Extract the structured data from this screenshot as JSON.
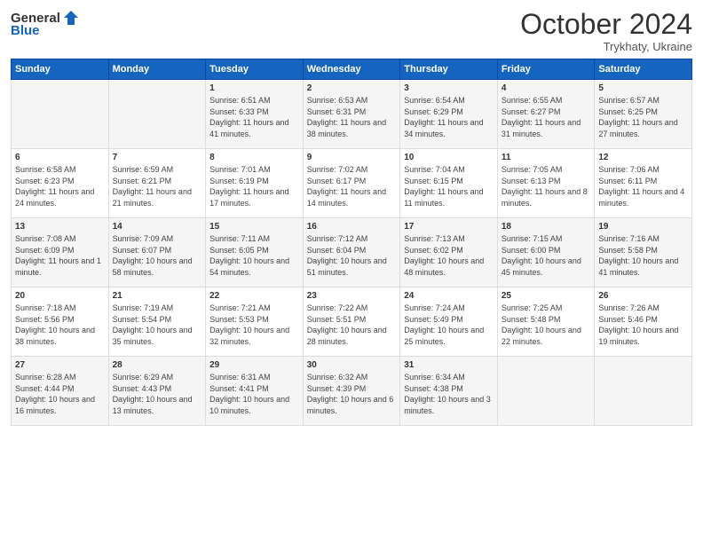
{
  "header": {
    "logo_general": "General",
    "logo_blue": "Blue",
    "month": "October 2024",
    "location": "Trykhaty, Ukraine"
  },
  "weekdays": [
    "Sunday",
    "Monday",
    "Tuesday",
    "Wednesday",
    "Thursday",
    "Friday",
    "Saturday"
  ],
  "weeks": [
    [
      {
        "day": "",
        "sunrise": "",
        "sunset": "",
        "daylight": ""
      },
      {
        "day": "",
        "sunrise": "",
        "sunset": "",
        "daylight": ""
      },
      {
        "day": "1",
        "sunrise": "Sunrise: 6:51 AM",
        "sunset": "Sunset: 6:33 PM",
        "daylight": "Daylight: 11 hours and 41 minutes."
      },
      {
        "day": "2",
        "sunrise": "Sunrise: 6:53 AM",
        "sunset": "Sunset: 6:31 PM",
        "daylight": "Daylight: 11 hours and 38 minutes."
      },
      {
        "day": "3",
        "sunrise": "Sunrise: 6:54 AM",
        "sunset": "Sunset: 6:29 PM",
        "daylight": "Daylight: 11 hours and 34 minutes."
      },
      {
        "day": "4",
        "sunrise": "Sunrise: 6:55 AM",
        "sunset": "Sunset: 6:27 PM",
        "daylight": "Daylight: 11 hours and 31 minutes."
      },
      {
        "day": "5",
        "sunrise": "Sunrise: 6:57 AM",
        "sunset": "Sunset: 6:25 PM",
        "daylight": "Daylight: 11 hours and 27 minutes."
      }
    ],
    [
      {
        "day": "6",
        "sunrise": "Sunrise: 6:58 AM",
        "sunset": "Sunset: 6:23 PM",
        "daylight": "Daylight: 11 hours and 24 minutes."
      },
      {
        "day": "7",
        "sunrise": "Sunrise: 6:59 AM",
        "sunset": "Sunset: 6:21 PM",
        "daylight": "Daylight: 11 hours and 21 minutes."
      },
      {
        "day": "8",
        "sunrise": "Sunrise: 7:01 AM",
        "sunset": "Sunset: 6:19 PM",
        "daylight": "Daylight: 11 hours and 17 minutes."
      },
      {
        "day": "9",
        "sunrise": "Sunrise: 7:02 AM",
        "sunset": "Sunset: 6:17 PM",
        "daylight": "Daylight: 11 hours and 14 minutes."
      },
      {
        "day": "10",
        "sunrise": "Sunrise: 7:04 AM",
        "sunset": "Sunset: 6:15 PM",
        "daylight": "Daylight: 11 hours and 11 minutes."
      },
      {
        "day": "11",
        "sunrise": "Sunrise: 7:05 AM",
        "sunset": "Sunset: 6:13 PM",
        "daylight": "Daylight: 11 hours and 8 minutes."
      },
      {
        "day": "12",
        "sunrise": "Sunrise: 7:06 AM",
        "sunset": "Sunset: 6:11 PM",
        "daylight": "Daylight: 11 hours and 4 minutes."
      }
    ],
    [
      {
        "day": "13",
        "sunrise": "Sunrise: 7:08 AM",
        "sunset": "Sunset: 6:09 PM",
        "daylight": "Daylight: 11 hours and 1 minute."
      },
      {
        "day": "14",
        "sunrise": "Sunrise: 7:09 AM",
        "sunset": "Sunset: 6:07 PM",
        "daylight": "Daylight: 10 hours and 58 minutes."
      },
      {
        "day": "15",
        "sunrise": "Sunrise: 7:11 AM",
        "sunset": "Sunset: 6:05 PM",
        "daylight": "Daylight: 10 hours and 54 minutes."
      },
      {
        "day": "16",
        "sunrise": "Sunrise: 7:12 AM",
        "sunset": "Sunset: 6:04 PM",
        "daylight": "Daylight: 10 hours and 51 minutes."
      },
      {
        "day": "17",
        "sunrise": "Sunrise: 7:13 AM",
        "sunset": "Sunset: 6:02 PM",
        "daylight": "Daylight: 10 hours and 48 minutes."
      },
      {
        "day": "18",
        "sunrise": "Sunrise: 7:15 AM",
        "sunset": "Sunset: 6:00 PM",
        "daylight": "Daylight: 10 hours and 45 minutes."
      },
      {
        "day": "19",
        "sunrise": "Sunrise: 7:16 AM",
        "sunset": "Sunset: 5:58 PM",
        "daylight": "Daylight: 10 hours and 41 minutes."
      }
    ],
    [
      {
        "day": "20",
        "sunrise": "Sunrise: 7:18 AM",
        "sunset": "Sunset: 5:56 PM",
        "daylight": "Daylight: 10 hours and 38 minutes."
      },
      {
        "day": "21",
        "sunrise": "Sunrise: 7:19 AM",
        "sunset": "Sunset: 5:54 PM",
        "daylight": "Daylight: 10 hours and 35 minutes."
      },
      {
        "day": "22",
        "sunrise": "Sunrise: 7:21 AM",
        "sunset": "Sunset: 5:53 PM",
        "daylight": "Daylight: 10 hours and 32 minutes."
      },
      {
        "day": "23",
        "sunrise": "Sunrise: 7:22 AM",
        "sunset": "Sunset: 5:51 PM",
        "daylight": "Daylight: 10 hours and 28 minutes."
      },
      {
        "day": "24",
        "sunrise": "Sunrise: 7:24 AM",
        "sunset": "Sunset: 5:49 PM",
        "daylight": "Daylight: 10 hours and 25 minutes."
      },
      {
        "day": "25",
        "sunrise": "Sunrise: 7:25 AM",
        "sunset": "Sunset: 5:48 PM",
        "daylight": "Daylight: 10 hours and 22 minutes."
      },
      {
        "day": "26",
        "sunrise": "Sunrise: 7:26 AM",
        "sunset": "Sunset: 5:46 PM",
        "daylight": "Daylight: 10 hours and 19 minutes."
      }
    ],
    [
      {
        "day": "27",
        "sunrise": "Sunrise: 6:28 AM",
        "sunset": "Sunset: 4:44 PM",
        "daylight": "Daylight: 10 hours and 16 minutes."
      },
      {
        "day": "28",
        "sunrise": "Sunrise: 6:29 AM",
        "sunset": "Sunset: 4:43 PM",
        "daylight": "Daylight: 10 hours and 13 minutes."
      },
      {
        "day": "29",
        "sunrise": "Sunrise: 6:31 AM",
        "sunset": "Sunset: 4:41 PM",
        "daylight": "Daylight: 10 hours and 10 minutes."
      },
      {
        "day": "30",
        "sunrise": "Sunrise: 6:32 AM",
        "sunset": "Sunset: 4:39 PM",
        "daylight": "Daylight: 10 hours and 6 minutes."
      },
      {
        "day": "31",
        "sunrise": "Sunrise: 6:34 AM",
        "sunset": "Sunset: 4:38 PM",
        "daylight": "Daylight: 10 hours and 3 minutes."
      },
      {
        "day": "",
        "sunrise": "",
        "sunset": "",
        "daylight": ""
      },
      {
        "day": "",
        "sunrise": "",
        "sunset": "",
        "daylight": ""
      }
    ]
  ]
}
